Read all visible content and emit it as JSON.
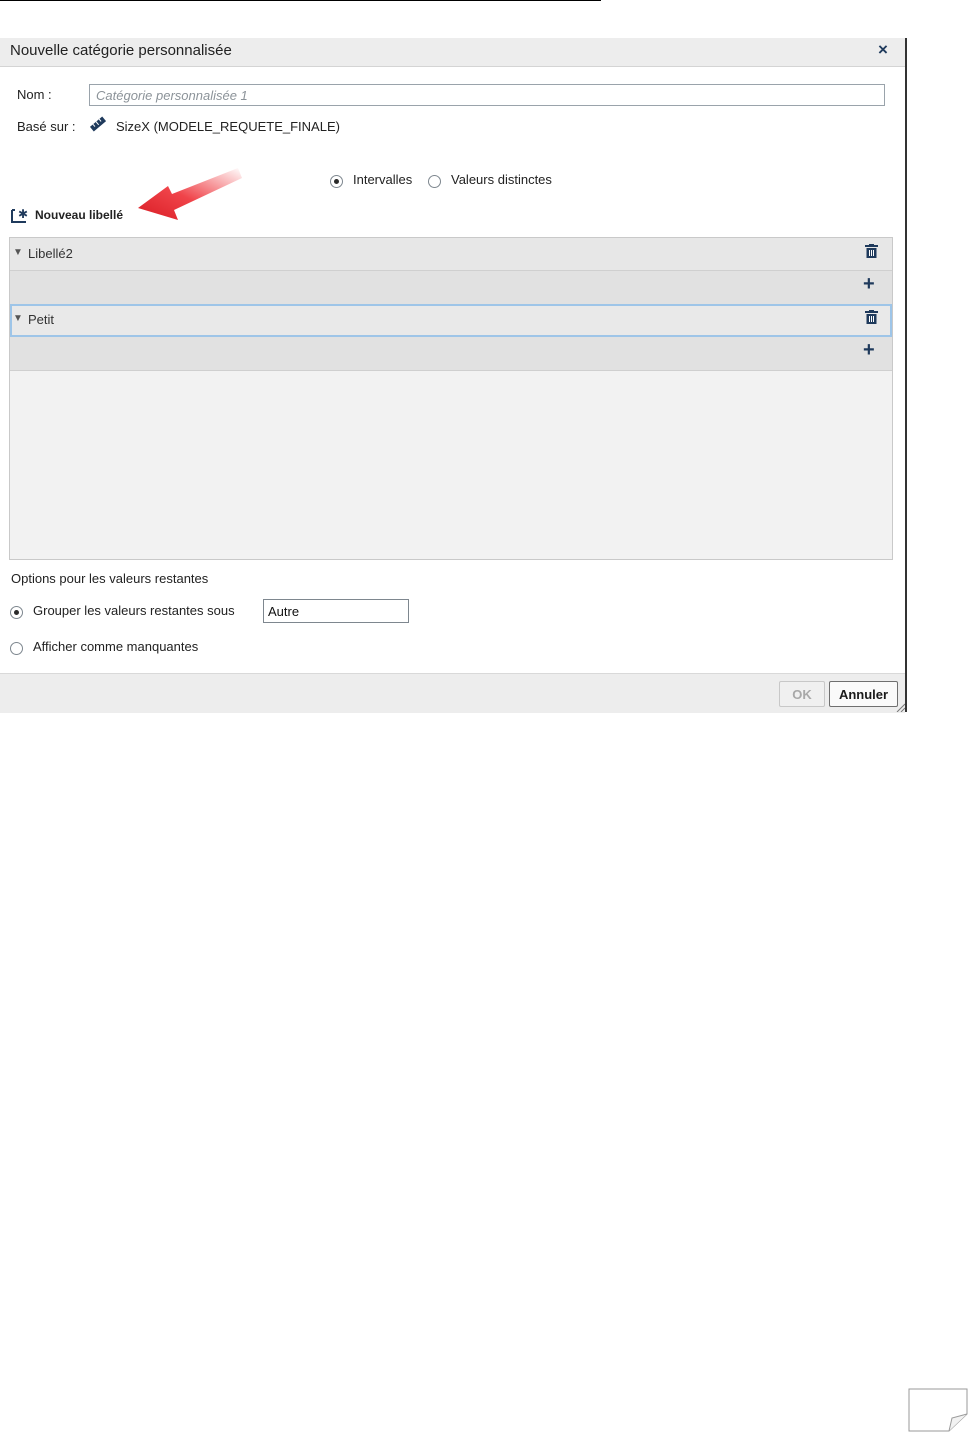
{
  "dialog": {
    "title": "Nouvelle catégorie personnalisée",
    "close_label": "×"
  },
  "form": {
    "name_label": "Nom :",
    "name_placeholder": "Catégorie personnalisée 1",
    "name_value": "",
    "based_on_label": "Basé sur :",
    "based_on_value": "SizeX (MODELE_REQUETE_FINALE)",
    "based_on_icon": "measure-icon"
  },
  "mode": {
    "options": [
      {
        "label": "Intervalles",
        "selected": true
      },
      {
        "label": "Valeurs distinctes",
        "selected": false
      }
    ]
  },
  "new_label_button": "Nouveau libellé",
  "labels": [
    {
      "name": "Libellé2",
      "selected": false
    },
    {
      "name": "Petit",
      "selected": true
    }
  ],
  "remaining": {
    "heading": "Options pour les valeurs restantes",
    "group_label": "Grouper les valeurs restantes sous",
    "group_value": "Autre",
    "group_selected": true,
    "missing_label": "Afficher comme manquantes",
    "missing_selected": false
  },
  "buttons": {
    "ok": "OK",
    "cancel": "Annuler"
  },
  "colors": {
    "accent": "#1f3a5c",
    "selection_border": "#9ec5e8",
    "arrow": "#e8232a"
  }
}
